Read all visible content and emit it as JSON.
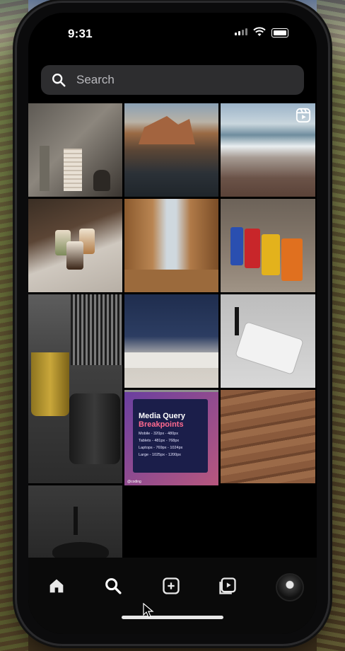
{
  "status_bar": {
    "time": "9:31"
  },
  "search": {
    "placeholder": "Search"
  },
  "grid": {
    "tiles": [
      {
        "name": "bathroom-pedestal-sink"
      },
      {
        "name": "rocky-coast"
      },
      {
        "name": "beach-waves-reel",
        "reel": true
      },
      {
        "name": "iced-lattes"
      },
      {
        "name": "canyon-rock-arch"
      },
      {
        "name": "colorful-cylinder-sinks"
      },
      {
        "name": "gold-black-washbasin"
      },
      {
        "name": "navy-kitchen"
      },
      {
        "name": "marble-vessel-sink"
      },
      {
        "name": "white-pedestal-basins"
      },
      {
        "name": "wooden-deck"
      },
      {
        "name": "dark-sink-mirror"
      }
    ]
  },
  "media_query_post": {
    "title": "Media Query",
    "subtitle": "Breakpoints",
    "lines": [
      "Mobile - 320px - 480px",
      "Tablets - 481px - 768px",
      "Laptops - 769px - 1024px",
      "Large - 1025px - 1200px"
    ],
    "handle": "@coding"
  },
  "tab_bar": {
    "items": [
      "home",
      "search",
      "create",
      "reels",
      "profile"
    ]
  },
  "colors": {
    "screen_bg": "#000000",
    "search_bg": "#2d2d2f",
    "accent_pink": "#ff6a8f"
  }
}
